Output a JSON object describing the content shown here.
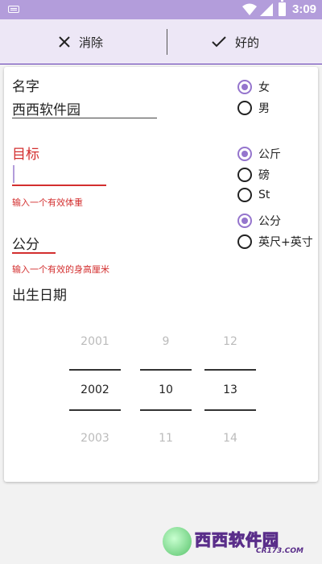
{
  "status_bar": {
    "time": "3:09"
  },
  "action_bar": {
    "cancel_label": "消除",
    "ok_label": "好的"
  },
  "form": {
    "name_label": "名字",
    "name_value": "西西软件园",
    "goal_label": "目标",
    "goal_value": "",
    "goal_error": "输入一个有效体重",
    "height_value": "公分",
    "height_error": "输入一个有效的身高厘米",
    "dob_label": "出生日期"
  },
  "gender": {
    "options": [
      "女",
      "男"
    ],
    "selected": "女"
  },
  "weight_unit": {
    "options": [
      "公斤",
      "磅",
      "St"
    ],
    "selected": "公斤"
  },
  "height_unit": {
    "options": [
      "公分",
      "英尺+英寸"
    ],
    "selected": "公分"
  },
  "date_picker": {
    "year": {
      "prev": "2001",
      "current": "2002",
      "next": "2003"
    },
    "month": {
      "prev": "9",
      "current": "10",
      "next": "11"
    },
    "day": {
      "prev": "12",
      "current": "13",
      "next": "14"
    }
  },
  "watermark": {
    "brand": "西西软件园",
    "domain": "CR173.COM"
  },
  "colors": {
    "status_bar": "#b39ddb",
    "action_bar": "#ede7f6",
    "accent": "#9575cd",
    "error": "#d32f2f"
  }
}
